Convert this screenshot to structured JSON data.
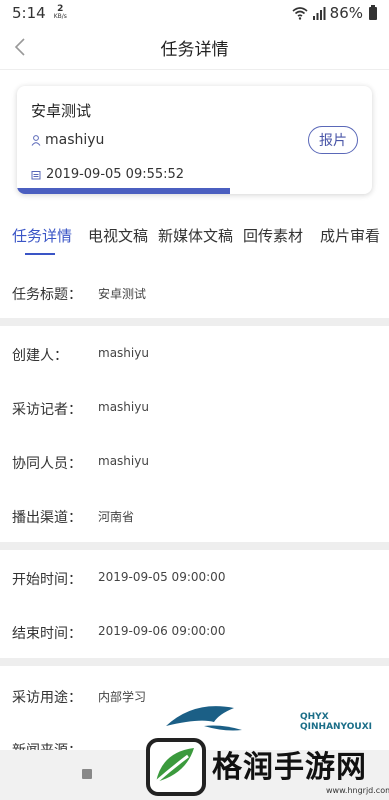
{
  "status_bar": {
    "time": "5:14",
    "net_speed_value": "2",
    "net_speed_unit": "KB/s",
    "battery": "86%"
  },
  "nav": {
    "title": "任务详情"
  },
  "card": {
    "title": "安卓测试",
    "reporter": "mashiyu",
    "date": "2019-09-05 09:55:52",
    "submit_label": "报片",
    "progress": 0.6
  },
  "tabs": [
    {
      "label": "任务详情",
      "active": true
    },
    {
      "label": "电视文稿",
      "active": false
    },
    {
      "label": "新媒体文稿",
      "active": false
    },
    {
      "label": "回传素材",
      "active": false
    },
    {
      "label": "成片审看",
      "active": false
    }
  ],
  "details": {
    "task_title": {
      "label": "任务标题：",
      "value": "安卓测试"
    },
    "creator": {
      "label": "创建人：",
      "value": "mashiyu"
    },
    "reporter": {
      "label": "采访记者：",
      "value": "mashiyu"
    },
    "collaborator": {
      "label": "协同人员：",
      "value": "mashiyu"
    },
    "channel": {
      "label": "播出渠道：",
      "value": "河南省"
    },
    "start_time": {
      "label": "开始时间：",
      "value": "2019-09-05 09:00:00"
    },
    "end_time": {
      "label": "结束时间：",
      "value": "2019-09-06 09:00:00"
    },
    "purpose": {
      "label": "采访用途：",
      "value": "内部学习"
    },
    "source": {
      "label": "新闻来源：",
      "value": ""
    }
  },
  "watermark": {
    "brand": "格润手游网",
    "sub1": "QHYX",
    "sub2": "QINHANYOUXI",
    "url": "www.hngrjd.com"
  },
  "colors": {
    "accent": "#3a55c6",
    "progress": "#4b5fc0",
    "divider": "#eeeeee"
  }
}
